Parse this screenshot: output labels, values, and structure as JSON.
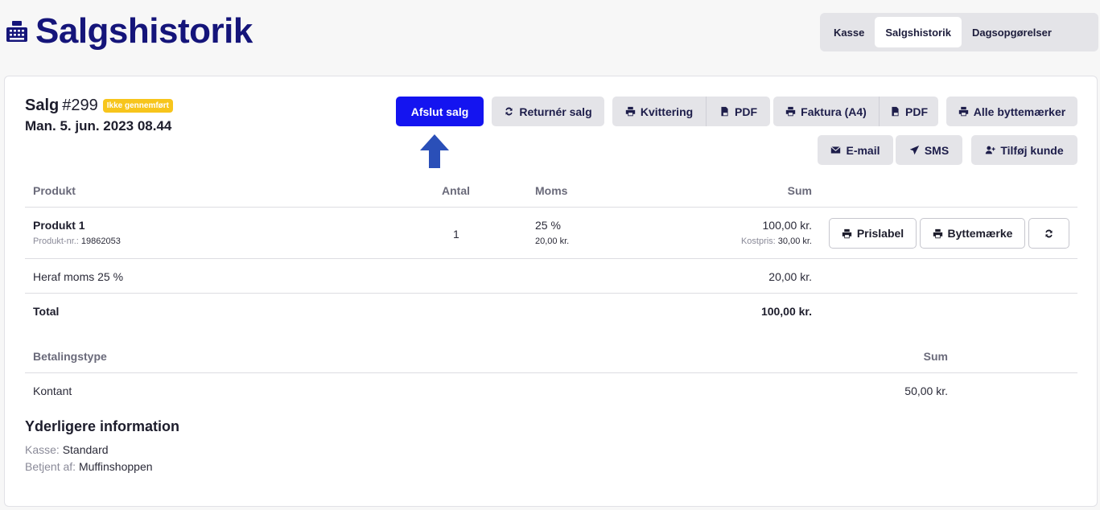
{
  "header": {
    "title": "Salgshistorik",
    "nav": [
      "Kasse",
      "Salgshistorik",
      "Dagsopgørelser"
    ],
    "active_nav": "Salgshistorik"
  },
  "sale": {
    "label": "Salg",
    "number": "#299",
    "status": "Ikke gennemført",
    "date": "Man. 5. jun. 2023 08.44"
  },
  "actions": {
    "finish": "Afslut salg",
    "return": "Returnér salg",
    "receipt": "Kvittering",
    "pdf": "PDF",
    "invoice": "Faktura (A4)",
    "pdf2": "PDF",
    "all_exchange": "Alle byttemærker",
    "email": "E-mail",
    "sms": "SMS",
    "add_customer": "Tilføj kunde"
  },
  "products_table": {
    "headers": [
      "Produkt",
      "Antal",
      "Moms",
      "Sum"
    ],
    "rows": [
      {
        "name": "Produkt 1",
        "sku_label": "Produkt-nr.:",
        "sku": "19862053",
        "qty": "1",
        "vat_rate": "25 %",
        "vat_amount": "20,00 kr.",
        "sum": "100,00 kr.",
        "cost_label": "Kostpris:",
        "cost": "30,00 kr.",
        "price_label_btn": "Prislabel",
        "exchange_btn": "Byttemærke"
      }
    ],
    "vat_row": {
      "label": "Heraf moms 25 %",
      "value": "20,00 kr."
    },
    "total_row": {
      "label": "Total",
      "value": "100,00 kr."
    }
  },
  "payments_table": {
    "headers": [
      "Betalingstype",
      "Sum"
    ],
    "rows": [
      {
        "type": "Kontant",
        "sum": "50,00 kr."
      }
    ]
  },
  "info": {
    "title": "Yderligere information",
    "register_label": "Kasse:",
    "register": "Standard",
    "served_label": "Betjent af:",
    "served_by": "Muffinshoppen"
  },
  "colors": {
    "brand": "#15157a",
    "primary_button": "#1414f0",
    "badge": "#f7c51c",
    "arrow": "#2a4fb8"
  }
}
